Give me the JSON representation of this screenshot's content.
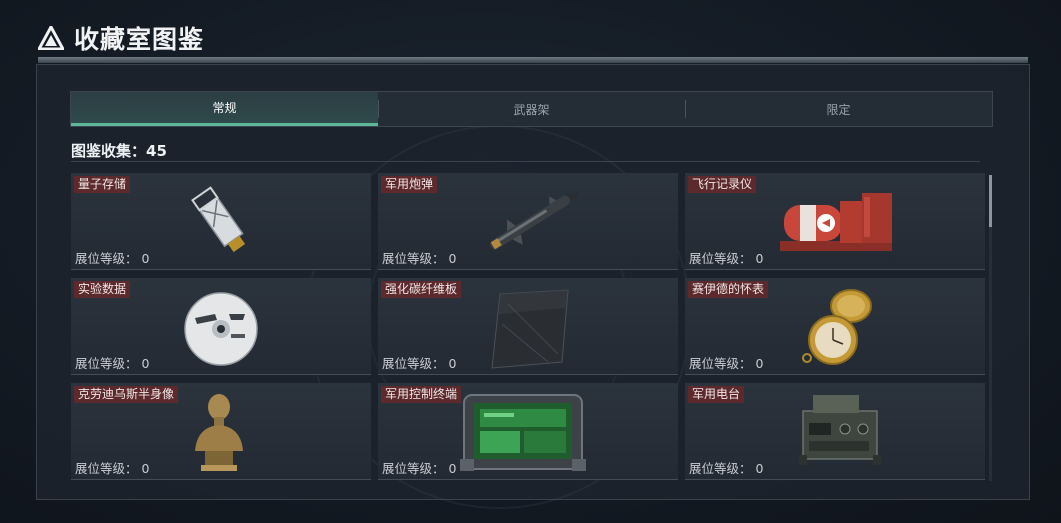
{
  "header": {
    "title": "收藏室图鉴",
    "icon": "triangle-logo-icon"
  },
  "tabs": [
    {
      "label": "常规",
      "active": true
    },
    {
      "label": "武器架",
      "active": false
    },
    {
      "label": "限定",
      "active": false
    }
  ],
  "collection": {
    "label": "图鉴收集：",
    "count": "45"
  },
  "items": [
    {
      "name": "量子存储",
      "level_label": "展位等级：",
      "level": "0",
      "icon": "usb-drive-icon"
    },
    {
      "name": "军用炮弹",
      "level_label": "展位等级：",
      "level": "0",
      "icon": "missile-icon"
    },
    {
      "name": "飞行记录仪",
      "level_label": "展位等级：",
      "level": "0",
      "icon": "flight-recorder-icon"
    },
    {
      "name": "实验数据",
      "level_label": "展位等级：",
      "level": "0",
      "icon": "disc-icon"
    },
    {
      "name": "强化碳纤维板",
      "level_label": "展位等级：",
      "level": "0",
      "icon": "carbon-plate-icon"
    },
    {
      "name": "赛伊德的怀表",
      "level_label": "展位等级：",
      "level": "0",
      "icon": "pocket-watch-icon"
    },
    {
      "name": "克劳迪乌斯半身像",
      "level_label": "展位等级：",
      "level": "0",
      "icon": "bust-icon"
    },
    {
      "name": "军用控制终端",
      "level_label": "展位等级：",
      "level": "0",
      "icon": "control-terminal-icon"
    },
    {
      "name": "军用电台",
      "level_label": "展位等级：",
      "level": "0",
      "icon": "radio-icon"
    }
  ]
}
